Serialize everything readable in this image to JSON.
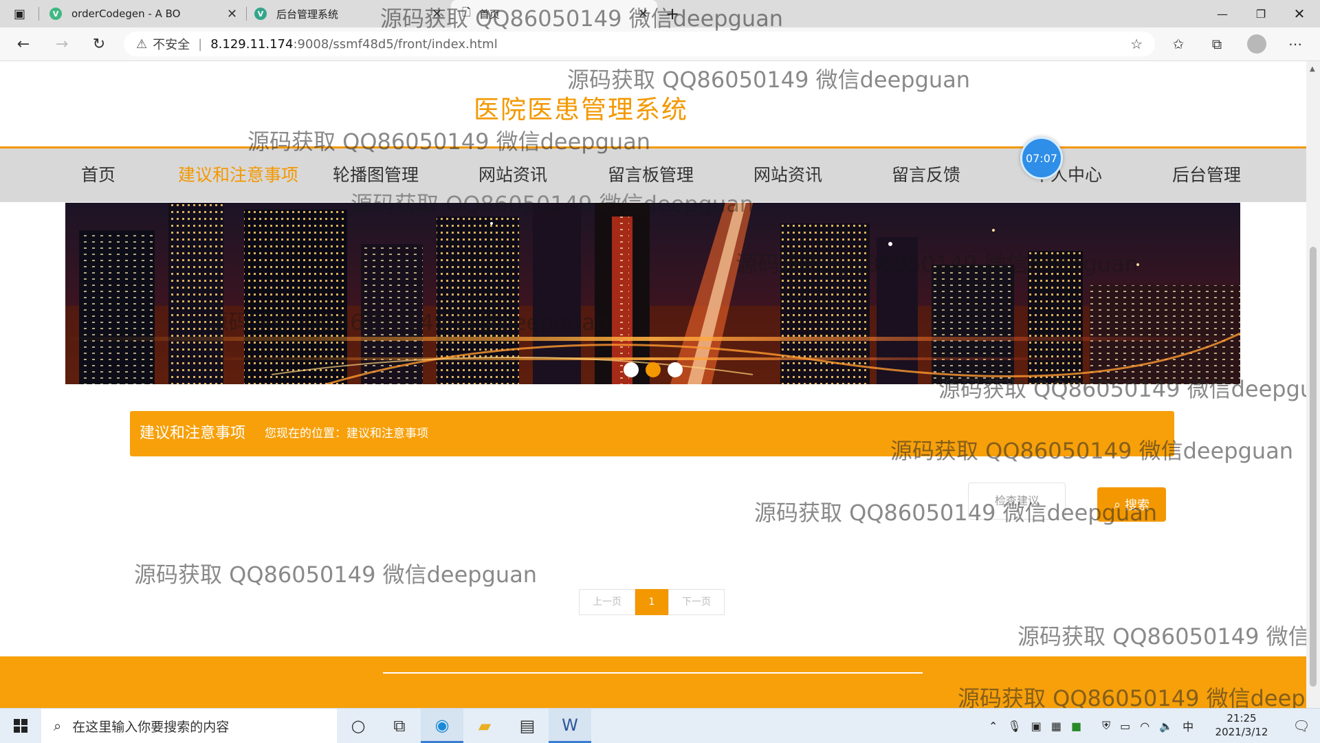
{
  "browser": {
    "tabs": [
      {
        "title": "orderCodegen - A BO",
        "icon": "vue-icon",
        "active": false
      },
      {
        "title": "后台管理系统",
        "icon": "vue-icon",
        "active": false
      },
      {
        "title": "首页",
        "icon": "page-icon",
        "active": true
      }
    ],
    "address": {
      "warning": "不安全",
      "host": "8.129.11.174",
      "path": ":9008/ssmf48d5/front/index.html"
    }
  },
  "site": {
    "title": "医院医患管理系统",
    "accent_color": "#f39800",
    "nav": [
      {
        "label": "首页",
        "active": false
      },
      {
        "label": "建议和注意事项",
        "active": true
      },
      {
        "label": "轮播图管理",
        "active": false
      },
      {
        "label": "网站资讯",
        "active": false
      },
      {
        "label": "留言板管理",
        "active": false
      },
      {
        "label": "网站资讯",
        "active": false
      },
      {
        "label": "留言反馈",
        "active": false
      },
      {
        "label": "个人中心",
        "active": false
      },
      {
        "label": "后台管理",
        "active": false
      }
    ],
    "clock_badge": "07:07",
    "banner": {
      "slide_count": 3,
      "active_index": 1
    },
    "breadcrumb": {
      "title": "建议和注意事项",
      "location": "您现在的位置：建议和注意事项"
    },
    "search": {
      "placeholder": "检查建议",
      "button_label": "搜索"
    },
    "pager": {
      "prev": "上一页",
      "current": "1",
      "next": "下一页"
    }
  },
  "watermark": "源码获取 QQ86050149 微信deepguan",
  "taskbar": {
    "search_placeholder": "在这里输入你要搜索的内容",
    "time": "21:25",
    "date": "2021/3/12",
    "ime": "中"
  }
}
